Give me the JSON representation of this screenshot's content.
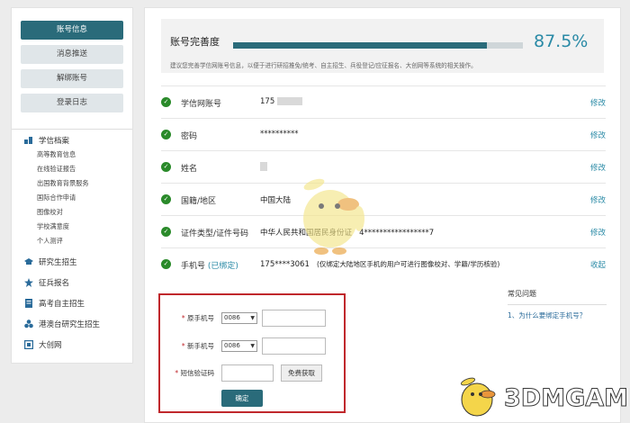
{
  "sidebar": {
    "buttons": [
      {
        "label": "账号信息"
      },
      {
        "label": "消息推送"
      },
      {
        "label": "解绑账号"
      },
      {
        "label": "登录日志"
      }
    ],
    "categories": [
      {
        "label": "学信档案",
        "icon": "archive-icon",
        "subitems": [
          "高等教育信息",
          "在线验证报告",
          "出国教育背景服务",
          "国际合作申请",
          "图像校对",
          "学校满意度",
          "个人测评"
        ]
      },
      {
        "label": "研究生招生",
        "icon": "graduation-cap-icon"
      },
      {
        "label": "征兵报名",
        "icon": "star-badge-icon"
      },
      {
        "label": "高考自主招生",
        "icon": "document-icon"
      },
      {
        "label": "港澳台研究生招生",
        "icon": "cluster-icon"
      },
      {
        "label": "大创网",
        "icon": "frame-icon"
      }
    ]
  },
  "progress": {
    "title": "账号完善度",
    "percent_label": "87.5%",
    "percent_value": 87.5,
    "hint": "建议您完善学信网账号信息，以便于进行研招推免/统考、自主招生、兵役登记/应征报名、大创网等系统的相关操作。"
  },
  "rows": [
    {
      "label": "学信网账号",
      "value": "175",
      "action": "修改"
    },
    {
      "label": "密码",
      "value": "**********",
      "action": "修改"
    },
    {
      "label": "姓名",
      "value": "",
      "action": "修改"
    },
    {
      "label": "国籍/地区",
      "value": "中国大陆",
      "action": "修改"
    },
    {
      "label": "证件类型/证件号码",
      "value": "中华人民共和国居民身份证",
      "value2": "4*****************7",
      "action": "修改"
    },
    {
      "label": "手机号",
      "tag": "(已绑定)",
      "value": "175****3061",
      "note": "(仅绑定大陆地区手机的用户可进行图像校对、学籍/学历核验)",
      "action": "收起"
    }
  ],
  "form": {
    "old_label": "原手机号",
    "new_label": "新手机号",
    "code_label": "短信验证码",
    "old_code": "0086",
    "new_code": "0086",
    "get_code_button": "免费获取",
    "submit_button": "确定"
  },
  "faq": {
    "title": "常见问题",
    "items": [
      "1、为什么要绑定手机号？"
    ]
  },
  "watermark": {
    "text": "3DMGAME"
  },
  "colors": {
    "primary": "#2a6b7a",
    "accent": "#2a8aa6",
    "highlight_border": "#c0282c",
    "check": "#2a8a2a"
  }
}
